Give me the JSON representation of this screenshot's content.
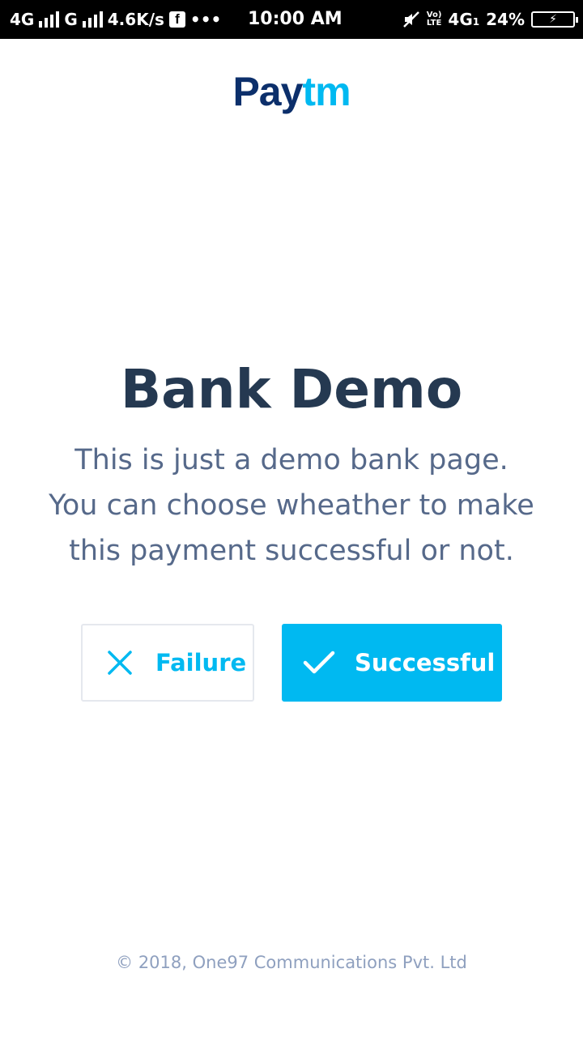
{
  "status_bar": {
    "network1": "4G",
    "network2": "G",
    "speed": "4.6K/s",
    "fb_letter": "f",
    "more": "•••",
    "time": "10:00 AM",
    "volte_top": "Vo)",
    "volte_bottom": "LTE",
    "network3": "4G",
    "sim_index": "1",
    "battery_percent": "24%",
    "battery_symbol": "⚡"
  },
  "logo": {
    "part1": "Pay",
    "part2": "tm",
    "colors": {
      "part1": "#0c2f6b",
      "part2": "#00b9f1"
    }
  },
  "main": {
    "title": "Bank Demo",
    "description_lines": [
      "This is just a demo bank page.",
      "You can choose wheather to make",
      "this payment successful or not."
    ]
  },
  "buttons": {
    "failure": {
      "label": "Failure",
      "icon": "close-icon"
    },
    "success": {
      "label": "Successful",
      "icon": "check-icon"
    }
  },
  "footer": {
    "copyright": "© 2018, One97 Communications Pvt. Ltd"
  },
  "colors": {
    "accent": "#00b9f1",
    "title": "#253951",
    "text": "#56698a",
    "footer": "#8fa0bf"
  }
}
